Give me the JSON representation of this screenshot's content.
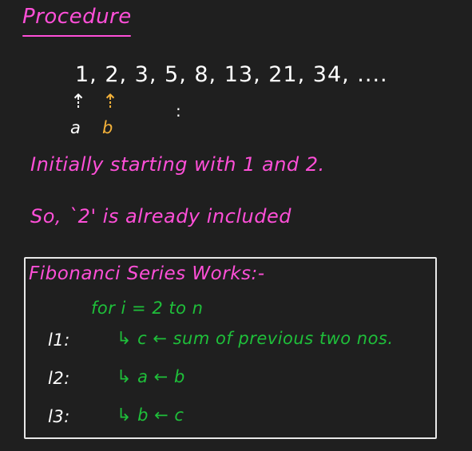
{
  "document": {
    "title": "Procedure",
    "sequence": "1, 2, 3, 5, 8, 13, 21, 34, ....",
    "pointer_a": "a",
    "pointer_b": "b",
    "up_arrow": "⇡",
    "dots": ":",
    "note_1": "Initially starting with 1 and 2.",
    "note_2": "So, `2' is already included",
    "box": {
      "title": "Fibonanci Series Works:-",
      "loop": "for i = 2 to n",
      "steps": [
        {
          "label": "l1:",
          "text": "c ← sum of previous two nos."
        },
        {
          "label": "l2:",
          "text": "a ← b"
        },
        {
          "label": "l3:",
          "text": "b ← c"
        }
      ],
      "hook": "↳"
    }
  },
  "colors": {
    "background": "#1f1f1f",
    "pink": "#ff4fd8",
    "green": "#1fbf3a",
    "orange": "#f3b13a",
    "white": "#ffffff"
  }
}
